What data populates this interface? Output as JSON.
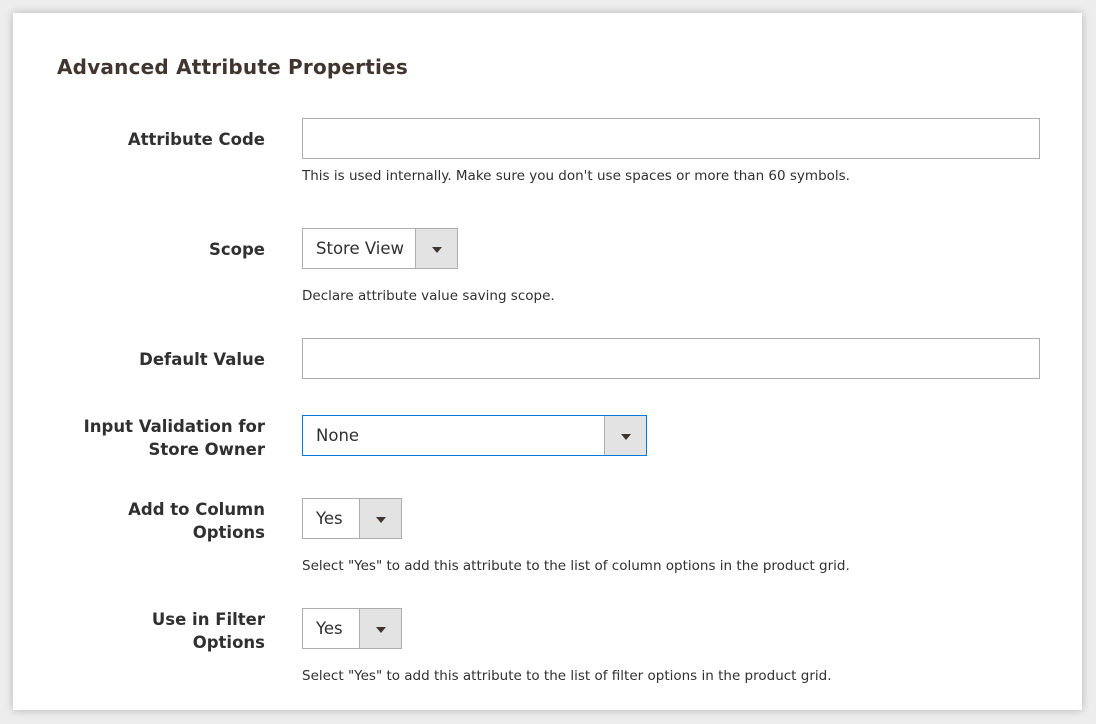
{
  "section": {
    "title": "Advanced Attribute Properties"
  },
  "fields": {
    "attribute_code": {
      "label": "Attribute Code",
      "value": "",
      "note": "This is used internally. Make sure you don't use spaces or more than 60 symbols."
    },
    "scope": {
      "label": "Scope",
      "selected": "Store View",
      "note": "Declare attribute value saving scope."
    },
    "default_value": {
      "label": "Default Value",
      "value": ""
    },
    "input_validation": {
      "label_line1": "Input Validation for",
      "label_line2": "Store Owner",
      "selected": "None"
    },
    "add_to_column": {
      "label_line1": "Add to Column",
      "label_line2": "Options",
      "selected": "Yes",
      "note": "Select \"Yes\" to add this attribute to the list of column options in the product grid."
    },
    "use_in_filter": {
      "label_line1": "Use in Filter",
      "label_line2": "Options",
      "selected": "Yes",
      "note": "Select \"Yes\" to add this attribute to the list of filter options in the product grid."
    }
  },
  "colors": {
    "focus_border": "#007bdb",
    "arrow_bg": "#e3e3e3",
    "border": "#adadad"
  },
  "icons": {
    "dropdown": "caret-down-icon"
  }
}
